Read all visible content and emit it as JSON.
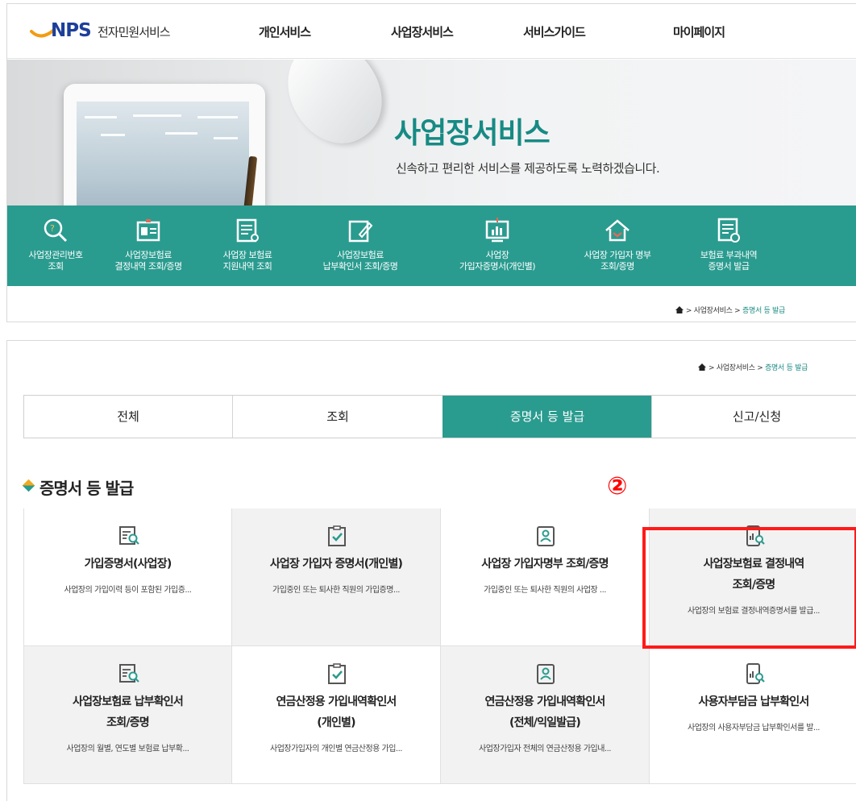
{
  "header": {
    "logo_text": "NPS",
    "logo_sub": "전자민원서비스",
    "nav": [
      "개인서비스",
      "사업장서비스",
      "서비스가이드",
      "마이페이지"
    ]
  },
  "banner": {
    "title": "사업장서비스",
    "subtitle": "신속하고 편리한 서비스를 제공하도록 노력하겠습니다."
  },
  "quick_menu": [
    {
      "line1": "사업장관리번호",
      "line2": "조회",
      "icon": "search-icon"
    },
    {
      "line1": "사업장보험료",
      "line2": "결정내역 조회/증명",
      "icon": "id-card-icon"
    },
    {
      "line1": "사업장 보험료",
      "line2": "지원내역 조회",
      "icon": "document-icon"
    },
    {
      "line1": "사업장보험료",
      "line2": "납부확인서 조회/증명",
      "icon": "edit-document-icon"
    },
    {
      "line1": "사업장",
      "line2": "가입자증명서(개인별)",
      "icon": "monitor-chart-icon"
    },
    {
      "line1": "사업장 가입자 명부",
      "line2": "조회/증명",
      "icon": "house-icon"
    },
    {
      "line1": "보험료 부과내역",
      "line2": "증명서 발급",
      "icon": "document-check-icon"
    }
  ],
  "breadcrumb_top": {
    "items": [
      "사업장서비스",
      "증명서 등 발급"
    ]
  },
  "breadcrumb_bottom": {
    "items": [
      "사업장서비스",
      "증명서 등 발급"
    ]
  },
  "tabs": [
    {
      "label": "전체",
      "active": false
    },
    {
      "label": "조회",
      "active": false
    },
    {
      "label": "증명서 등 발급",
      "active": true
    },
    {
      "label": "신고/신청",
      "active": false
    }
  ],
  "section": {
    "title": "증명서 등 발급",
    "step_marker": "②"
  },
  "cards": [
    {
      "title_lines": [
        "가입증명서(사업장)"
      ],
      "desc": "사업장의 가입이력 등이 포함된 가입증...",
      "icon": "document-search-icon"
    },
    {
      "title_lines": [
        "사업장 가입자 증명서(개인별)"
      ],
      "desc": "가입중인 또는 퇴사한 직원의 가입증명...",
      "icon": "clipboard-check-icon"
    },
    {
      "title_lines": [
        "사업장 가입자명부 조회/증명"
      ],
      "desc": "가입중인 또는 퇴사한 직원의 사업장 ...",
      "icon": "person-card-icon"
    },
    {
      "title_lines": [
        "사업장보험료 결정내역",
        "조회/증명"
      ],
      "desc": "사업장의 보험료 결정내역증명서를 발급...",
      "icon": "phone-chart-search-icon"
    },
    {
      "title_lines": [
        "사업장보험료 납부확인서",
        "조회/증명"
      ],
      "desc": "사업장의 월별, 연도별 보험료 납부확...",
      "icon": "document-search-icon"
    },
    {
      "title_lines": [
        "연금산정용 가입내역확인서",
        "(개인별)"
      ],
      "desc": "사업장가입자의 개인별 연금산정용 가입...",
      "icon": "clipboard-check-icon"
    },
    {
      "title_lines": [
        "연금산정용 가입내역확인서",
        "(전체/익일발급)"
      ],
      "desc": "사업장가입자 전체의 연금산정용 가입내...",
      "icon": "person-card-icon"
    },
    {
      "title_lines": [
        "사용자부담금 납부확인서"
      ],
      "desc": "사업장의 사용자부담금 납부확인서를 발...",
      "icon": "phone-chart-search-icon"
    }
  ],
  "colors": {
    "accent": "#2a9b8f",
    "highlight": "#ff1a1a",
    "title_green": "#178a84"
  }
}
